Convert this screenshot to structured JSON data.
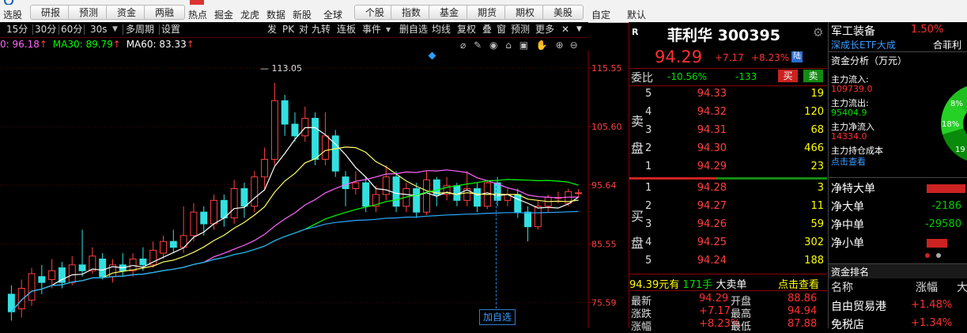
{
  "toolbar": {
    "left_labels": [
      "选股",
      "热点",
      "掘金",
      "龙虎",
      "数据",
      "新股",
      "全球",
      "自定",
      "默认"
    ],
    "buttons_a": [
      "研报",
      "预测",
      "资金",
      "两融"
    ],
    "buttons_b": [
      "个股",
      "指数",
      "基金",
      "期货",
      "期权",
      "美股"
    ]
  },
  "periodbar": {
    "items": [
      "15分",
      "30分",
      "60分",
      "30s",
      "多周期",
      "设置"
    ],
    "right_items": [
      "发",
      "PK",
      "对",
      "九转",
      "连板",
      "事件",
      "删自选",
      "均线",
      "复权",
      "叠",
      "窗",
      "预测",
      "更多"
    ]
  },
  "ma_legend": {
    "ma20": "0: 96.18",
    "ma30": "MA30: 89.79",
    "ma60": "MA60: 83.33",
    "colors": {
      "ma20": "#ff66ff",
      "ma30": "#00ff00",
      "ma60": "#ffffff"
    }
  },
  "chart": {
    "y_axis_labels": [
      "115.55",
      "105.60",
      "95.64",
      "85.55",
      "75.59"
    ],
    "high_marker": "113.05",
    "add_watch_label": "加自选"
  },
  "chart_data": {
    "type": "candlestick",
    "title": "",
    "y_ticks": [
      115.55,
      105.6,
      95.64,
      85.55,
      75.59
    ],
    "ylim": [
      72.0,
      118.0
    ],
    "high_annotation": 113.05,
    "candles": [
      {
        "o": 77.0,
        "c": 74.0,
        "h": 78.5,
        "l": 72.5
      },
      {
        "o": 74.5,
        "c": 78.0,
        "h": 79.5,
        "l": 73.0
      },
      {
        "o": 76.0,
        "c": 80.5,
        "h": 81.5,
        "l": 75.0
      },
      {
        "o": 80.0,
        "c": 79.0,
        "h": 82.0,
        "l": 77.0
      },
      {
        "o": 79.5,
        "c": 81.0,
        "h": 83.0,
        "l": 78.0
      },
      {
        "o": 81.5,
        "c": 79.0,
        "h": 82.5,
        "l": 78.0
      },
      {
        "o": 79.0,
        "c": 82.0,
        "h": 83.5,
        "l": 78.5
      },
      {
        "o": 82.0,
        "c": 81.0,
        "h": 88.0,
        "l": 80.0
      },
      {
        "o": 81.0,
        "c": 83.5,
        "h": 85.0,
        "l": 80.5
      },
      {
        "o": 83.0,
        "c": 80.0,
        "h": 84.0,
        "l": 79.5
      },
      {
        "o": 80.0,
        "c": 82.0,
        "h": 83.0,
        "l": 79.0
      },
      {
        "o": 82.0,
        "c": 81.0,
        "h": 84.0,
        "l": 80.0
      },
      {
        "o": 81.0,
        "c": 83.0,
        "h": 84.0,
        "l": 80.0
      },
      {
        "o": 83.0,
        "c": 82.0,
        "h": 85.0,
        "l": 81.0
      },
      {
        "o": 82.0,
        "c": 84.5,
        "h": 86.0,
        "l": 81.5
      },
      {
        "o": 84.0,
        "c": 86.0,
        "h": 87.0,
        "l": 83.0
      },
      {
        "o": 86.0,
        "c": 85.0,
        "h": 88.0,
        "l": 84.0
      },
      {
        "o": 85.0,
        "c": 87.0,
        "h": 92.0,
        "l": 84.0
      },
      {
        "o": 87.0,
        "c": 91.0,
        "h": 92.5,
        "l": 86.0
      },
      {
        "o": 91.0,
        "c": 89.0,
        "h": 92.0,
        "l": 87.0
      },
      {
        "o": 89.0,
        "c": 93.0,
        "h": 94.0,
        "l": 88.0
      },
      {
        "o": 93.0,
        "c": 90.0,
        "h": 94.0,
        "l": 88.5
      },
      {
        "o": 90.0,
        "c": 95.0,
        "h": 96.5,
        "l": 89.0
      },
      {
        "o": 95.0,
        "c": 92.0,
        "h": 96.0,
        "l": 90.0
      },
      {
        "o": 92.0,
        "c": 97.0,
        "h": 98.0,
        "l": 91.0
      },
      {
        "o": 97.0,
        "c": 100.0,
        "h": 102.0,
        "l": 95.0
      },
      {
        "o": 100.0,
        "c": 110.0,
        "h": 113.05,
        "l": 99.0
      },
      {
        "o": 110.0,
        "c": 106.0,
        "h": 111.0,
        "l": 104.0
      },
      {
        "o": 106.0,
        "c": 104.0,
        "h": 108.0,
        "l": 103.0
      },
      {
        "o": 104.0,
        "c": 107.0,
        "h": 109.0,
        "l": 103.0
      },
      {
        "o": 107.0,
        "c": 100.0,
        "h": 108.0,
        "l": 99.0
      },
      {
        "o": 100.0,
        "c": 104.0,
        "h": 108.0,
        "l": 99.0
      },
      {
        "o": 104.0,
        "c": 98.0,
        "h": 105.0,
        "l": 97.0
      },
      {
        "o": 97.0,
        "c": 95.0,
        "h": 98.0,
        "l": 92.0
      },
      {
        "o": 95.0,
        "c": 96.0,
        "h": 98.0,
        "l": 94.0
      },
      {
        "o": 96.0,
        "c": 92.0,
        "h": 97.0,
        "l": 91.0
      },
      {
        "o": 92.0,
        "c": 94.0,
        "h": 95.5,
        "l": 91.0
      },
      {
        "o": 94.0,
        "c": 97.0,
        "h": 99.0,
        "l": 93.0
      },
      {
        "o": 97.0,
        "c": 92.0,
        "h": 98.0,
        "l": 91.0
      },
      {
        "o": 92.0,
        "c": 95.0,
        "h": 96.0,
        "l": 91.0
      },
      {
        "o": 95.0,
        "c": 91.0,
        "h": 96.0,
        "l": 90.0
      },
      {
        "o": 91.0,
        "c": 96.5,
        "h": 98.0,
        "l": 90.5
      },
      {
        "o": 96.5,
        "c": 94.0,
        "h": 97.0,
        "l": 92.0
      },
      {
        "o": 94.0,
        "c": 95.5,
        "h": 97.0,
        "l": 93.0
      },
      {
        "o": 95.5,
        "c": 93.0,
        "h": 96.0,
        "l": 92.0
      },
      {
        "o": 93.0,
        "c": 95.0,
        "h": 98.0,
        "l": 92.0
      },
      {
        "o": 95.0,
        "c": 92.0,
        "h": 96.0,
        "l": 91.0
      },
      {
        "o": 92.0,
        "c": 96.0,
        "h": 96.5,
        "l": 91.5
      },
      {
        "o": 96.0,
        "c": 93.0,
        "h": 97.0,
        "l": 92.0
      },
      {
        "o": 93.0,
        "c": 94.0,
        "h": 95.0,
        "l": 92.0
      },
      {
        "o": 94.0,
        "c": 91.0,
        "h": 95.0,
        "l": 90.0
      },
      {
        "o": 91.0,
        "c": 88.5,
        "h": 92.0,
        "l": 86.0
      },
      {
        "o": 88.5,
        "c": 92.0,
        "h": 93.0,
        "l": 88.0
      },
      {
        "o": 92.0,
        "c": 93.5,
        "h": 94.0,
        "l": 91.0
      },
      {
        "o": 93.5,
        "c": 93.5,
        "h": 94.5,
        "l": 92.5
      },
      {
        "o": 92.5,
        "c": 94.5,
        "h": 95.0,
        "l": 92.0
      },
      {
        "o": 94.2,
        "c": 94.29,
        "h": 94.94,
        "l": 93.5
      }
    ]
  },
  "stock": {
    "name": "菲利华 300395",
    "price": "94.29",
    "change": "+7.17",
    "change_pct": "+8.23%",
    "exchange_tag": "陆",
    "r_tag": "R"
  },
  "orderbook": {
    "weibi_label": "委比",
    "weibi_pct": "-10.56%",
    "weicha": "-133",
    "sell_btn": "买",
    "buy_btn": "卖",
    "sell_side_chars": [
      "卖",
      "盘"
    ],
    "buy_side_chars": [
      "买",
      "盘"
    ],
    "asks": [
      {
        "lvl": "5",
        "price": "94.33",
        "vol": "19"
      },
      {
        "lvl": "4",
        "price": "94.32",
        "vol": "120"
      },
      {
        "lvl": "3",
        "price": "94.31",
        "vol": "68"
      },
      {
        "lvl": "2",
        "price": "94.30",
        "vol": "466"
      },
      {
        "lvl": "1",
        "price": "94.29",
        "vol": "23"
      }
    ],
    "bids": [
      {
        "lvl": "1",
        "price": "94.28",
        "vol": "3"
      },
      {
        "lvl": "2",
        "price": "94.27",
        "vol": "11"
      },
      {
        "lvl": "3",
        "price": "94.26",
        "vol": "59"
      },
      {
        "lvl": "4",
        "price": "94.25",
        "vol": "302"
      },
      {
        "lvl": "5",
        "price": "94.24",
        "vol": "188"
      }
    ],
    "big_order": {
      "price": "94.39元有",
      "qty": "171手",
      "label": "大卖单",
      "link": "点击查看"
    },
    "summary": [
      {
        "k": "最新",
        "v": "94.29",
        "k2": "开盘",
        "v2": "88.86"
      },
      {
        "k": "涨跌",
        "v": "+7.17",
        "k2": "最高",
        "v2": "94.94"
      },
      {
        "k": "涨幅",
        "v": "+8.23%",
        "k2": "最低",
        "v2": "87.88"
      }
    ]
  },
  "sidepanel": {
    "sector": "军工装备",
    "sector_pct": "1.50%",
    "etf": "深成长ETF大成",
    "etf2": "合菲利",
    "fund_title": "资金分析（万元）",
    "inflow_label": "主力流入:",
    "inflow": "109739.0",
    "outflow_label": "主力流出:",
    "outflow": "95404.9",
    "net_label": "主力净流入",
    "net": "14334.0",
    "cost_label": "主力持仓成本",
    "cost_link": "点击查看",
    "pie_labels": [
      "8%",
      "18%",
      "19"
    ],
    "nets": [
      {
        "label": "净特大单",
        "value": "",
        "color": "#cc2222",
        "bar": 0.95
      },
      {
        "label": "净大单",
        "value": "-2186",
        "color": "#00cc00",
        "bar": 0.0
      },
      {
        "label": "净中单",
        "value": "-29580",
        "color": "#00cc00",
        "bar": 0.0
      },
      {
        "label": "净小单",
        "value": "",
        "color": "#cc2222",
        "bar": 0.5
      }
    ],
    "rank_title": "资金排名",
    "rank_headers": [
      "名称",
      "涨幅",
      "大"
    ],
    "rank_rows": [
      {
        "name": "自由贸易港",
        "pct": "+1.48%"
      },
      {
        "name": "免税店",
        "pct": "+1.34%"
      }
    ]
  }
}
